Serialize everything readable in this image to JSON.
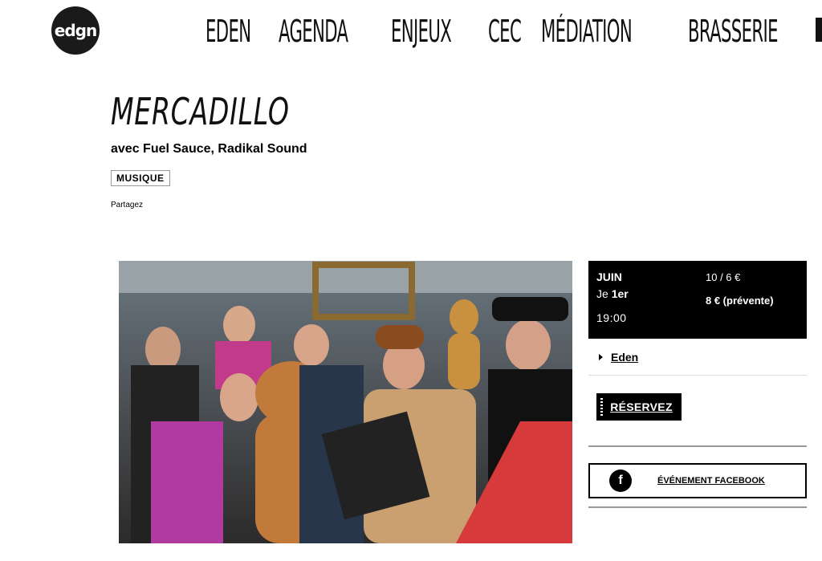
{
  "header": {
    "logo_text": "edgn",
    "nav": [
      "EDEN",
      "AGENDA",
      "ENJEUX",
      "CEC",
      "MÉDIATION",
      "BRASSERIE"
    ]
  },
  "event": {
    "title": "MERCADILLO",
    "subtitle": "avec Fuel Sauce, Radikal Sound",
    "tag": "MUSIQUE",
    "share_label": "Partagez"
  },
  "info": {
    "month": "JUIN",
    "day_prefix": "Je",
    "day": "1er",
    "time": "19:00",
    "price_regular": "10 / 6 €",
    "price_presale": "8 € (prévente)"
  },
  "venue": {
    "label": "Eden"
  },
  "reserve_label": "RÉSERVEZ",
  "facebook": {
    "icon": "facebook-icon",
    "label": "ÉVÉNEMENT FACEBOOK"
  }
}
